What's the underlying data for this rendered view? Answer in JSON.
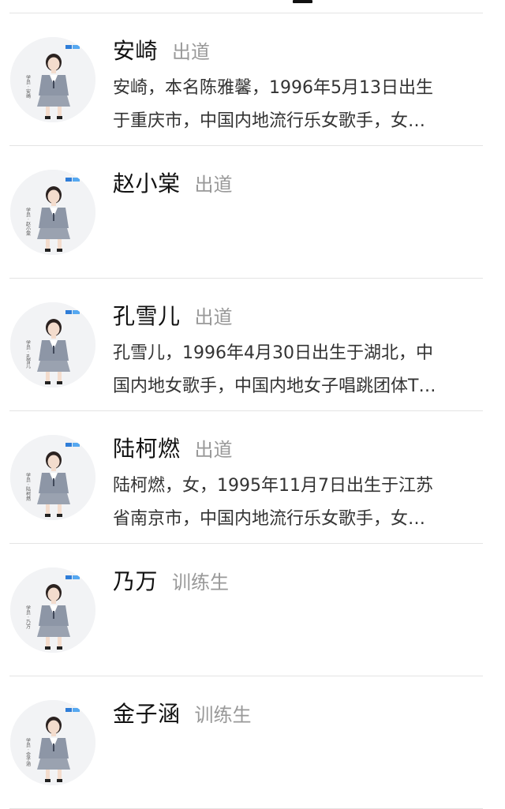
{
  "colors": {
    "background": "#ffffff",
    "name": "#111111",
    "tag": "#999999",
    "description": "#333333",
    "divider": "#e4e4e4"
  },
  "items": [
    {
      "name": "安崎",
      "tag": "出道",
      "desc_line1": "安崎，本名陈雅馨，1996年5月13日出生",
      "desc_line2": "于重庆市，中国内地流行乐女歌手，女…",
      "avatar_caption": "学员 · 安崎",
      "avatar_icon": "trainee-portrait-icon"
    },
    {
      "name": "赵小棠",
      "tag": "出道",
      "desc_line1": "",
      "desc_line2": "",
      "avatar_caption": "学员 · 赵小棠",
      "avatar_icon": "trainee-portrait-icon"
    },
    {
      "name": "孔雪儿",
      "tag": "出道",
      "desc_line1": "孔雪儿，1996年4月30日出生于湖北，中",
      "desc_line2": "国内地女歌手，中国内地女子唱跳团体T…",
      "avatar_caption": "学员 · 孔雪儿",
      "avatar_icon": "trainee-portrait-icon"
    },
    {
      "name": "陆柯燃",
      "tag": "出道",
      "desc_line1": "陆柯燃，女，1995年11月7日出生于江苏",
      "desc_line2": "省南京市，中国内地流行乐女歌手，女…",
      "avatar_caption": "学员 · 陆柯燃",
      "avatar_icon": "trainee-portrait-icon"
    },
    {
      "name": "乃万",
      "tag": "训练生",
      "desc_line1": "",
      "desc_line2": "",
      "avatar_caption": "学员 · 乃万",
      "avatar_icon": "trainee-portrait-icon"
    },
    {
      "name": "金子涵",
      "tag": "训练生",
      "desc_line1": "",
      "desc_line2": "",
      "avatar_caption": "学员 · 金子涵",
      "avatar_icon": "trainee-portrait-icon"
    }
  ]
}
